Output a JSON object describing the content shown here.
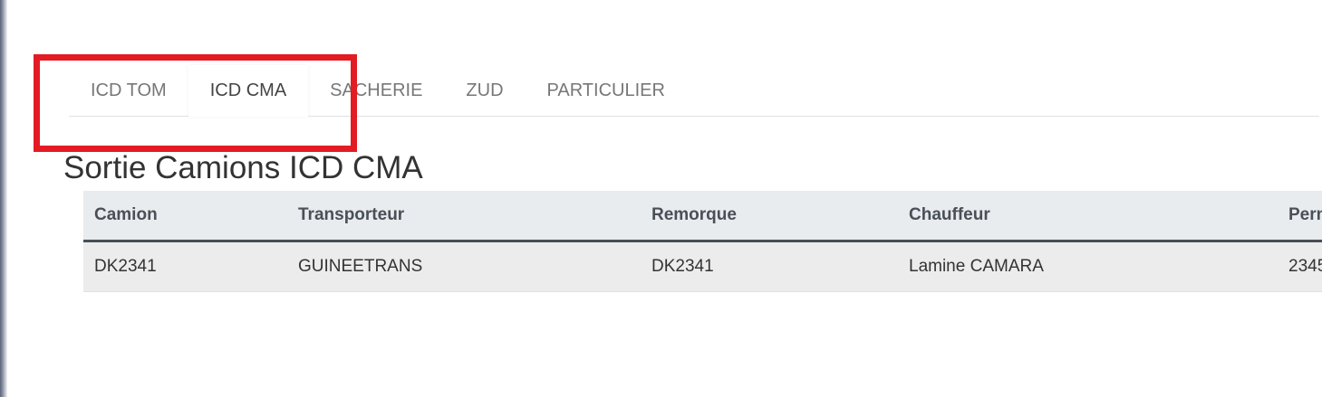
{
  "tabs": [
    {
      "label": "ICD TOM",
      "active": false
    },
    {
      "label": "ICD CMA",
      "active": true
    },
    {
      "label": "SACHERIE",
      "active": false
    },
    {
      "label": "ZUD",
      "active": false
    },
    {
      "label": "PARTICULIER",
      "active": false
    }
  ],
  "highlight_color": "#e31b23",
  "page_title": "Sortie Camions ICD CMA",
  "table": {
    "columns": [
      "Camion",
      "Transporteur",
      "Remorque",
      "Chauffeur",
      "Permis"
    ],
    "rows": [
      [
        "DK2341",
        "GUINEETRANS",
        "DK2341",
        "Lamine CAMARA",
        "2345"
      ]
    ]
  }
}
